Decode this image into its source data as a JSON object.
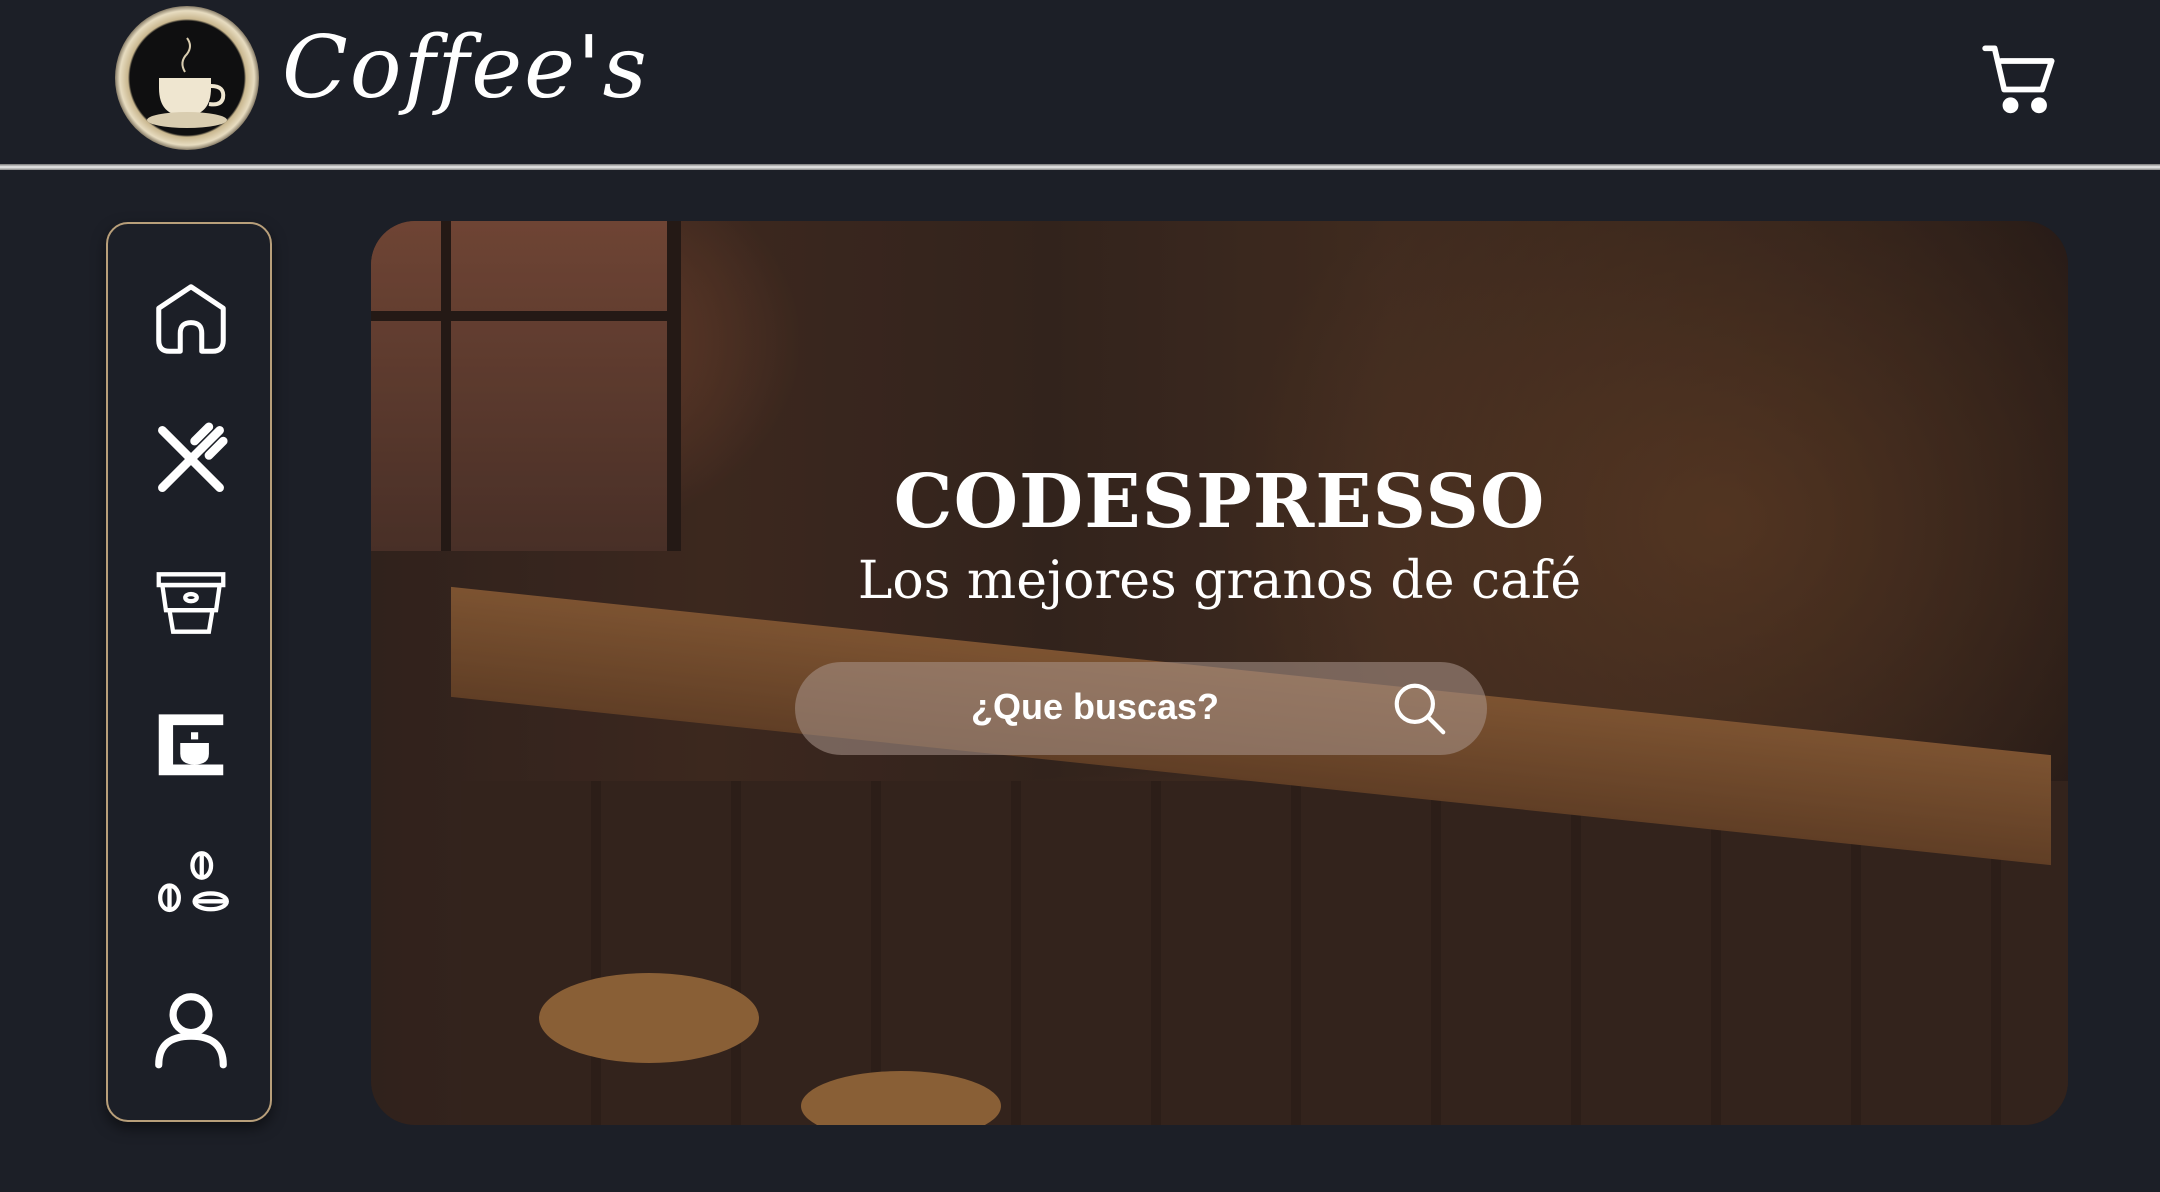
{
  "header": {
    "brand": "Coffee's",
    "logo_text": "CODESPRESSO",
    "cart_icon": "cart-icon"
  },
  "sidebar": {
    "items": [
      {
        "name": "home",
        "icon": "home-icon"
      },
      {
        "name": "menu",
        "icon": "knife-fork-icon"
      },
      {
        "name": "coffee-cup",
        "icon": "coffee-cup-icon"
      },
      {
        "name": "coffee-machine",
        "icon": "coffee-machine-icon"
      },
      {
        "name": "coffee-beans",
        "icon": "coffee-beans-icon"
      },
      {
        "name": "profile",
        "icon": "user-icon"
      }
    ]
  },
  "hero": {
    "title": "CODESPRESSO",
    "subtitle": "Los mejores granos de café",
    "search_placeholder": "¿Que buscas?"
  },
  "colors": {
    "background": "#1c1f27",
    "sidebar_border": "#b89f7a"
  }
}
